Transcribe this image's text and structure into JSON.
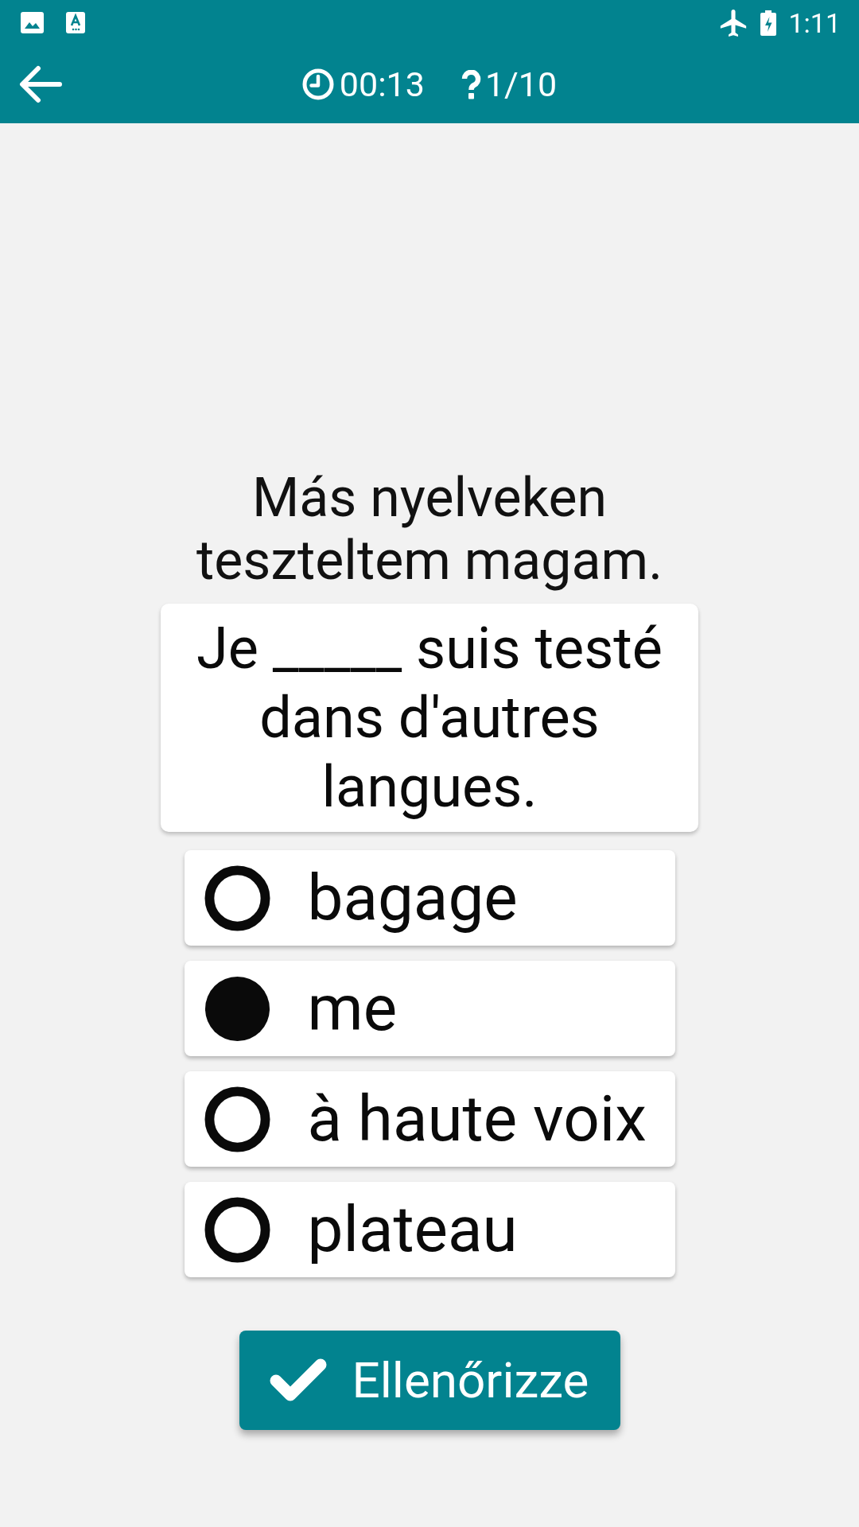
{
  "status_bar": {
    "time": "1:11"
  },
  "toolbar": {
    "timer": "00:13",
    "progress": "1/10"
  },
  "prompt": "Más nyelveken teszteltem magam.",
  "sentence": "Je _____ suis testé dans d'autres langues.",
  "options": [
    {
      "label": "bagage",
      "selected": false
    },
    {
      "label": "me",
      "selected": true
    },
    {
      "label": "à haute voix",
      "selected": false
    },
    {
      "label": "plateau",
      "selected": false
    }
  ],
  "check_button": {
    "label": "Ellenőrizze"
  }
}
